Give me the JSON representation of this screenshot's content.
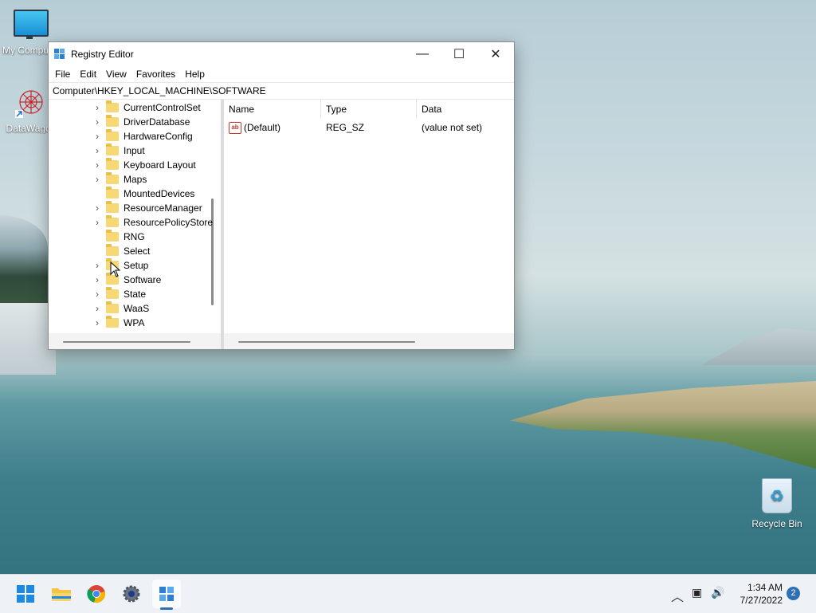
{
  "desktop": {
    "icons": [
      {
        "label": "My Computer"
      },
      {
        "label": "DataWagon"
      },
      {
        "label": "Recycle Bin"
      }
    ]
  },
  "window": {
    "title": "Registry Editor",
    "controls": {
      "minimize": "—",
      "maximize": "☐",
      "close": "✕"
    },
    "menu": [
      "File",
      "Edit",
      "View",
      "Favorites",
      "Help"
    ],
    "address": "Computer\\HKEY_LOCAL_MACHINE\\SOFTWARE",
    "tree": [
      {
        "label": "CurrentControlSet",
        "expandable": true
      },
      {
        "label": "DriverDatabase",
        "expandable": true
      },
      {
        "label": "HardwareConfig",
        "expandable": true
      },
      {
        "label": "Input",
        "expandable": true
      },
      {
        "label": "Keyboard Layout",
        "expandable": true
      },
      {
        "label": "Maps",
        "expandable": true
      },
      {
        "label": "MountedDevices",
        "expandable": false
      },
      {
        "label": "ResourceManager",
        "expandable": true
      },
      {
        "label": "ResourcePolicyStore",
        "expandable": true
      },
      {
        "label": "RNG",
        "expandable": false
      },
      {
        "label": "Select",
        "expandable": false
      },
      {
        "label": "Setup",
        "expandable": true
      },
      {
        "label": "Software",
        "expandable": true
      },
      {
        "label": "State",
        "expandable": true
      },
      {
        "label": "WaaS",
        "expandable": true
      },
      {
        "label": "WPA",
        "expandable": true
      }
    ],
    "columns": {
      "name": "Name",
      "type": "Type",
      "data": "Data"
    },
    "rows": [
      {
        "icon": "ab",
        "name": "(Default)",
        "type": "REG_SZ",
        "data": "(value not set)"
      }
    ]
  },
  "taskbar": {
    "clock_time": "1:34 AM",
    "clock_date": "7/27/2022",
    "notification_count": "2",
    "apps": [
      "start-icon",
      "file-explorer-icon",
      "chrome-icon",
      "settings-icon",
      "registry-editor-icon"
    ]
  },
  "colors": {
    "accent": "#2f6fb5",
    "folder": "#f8d775"
  }
}
